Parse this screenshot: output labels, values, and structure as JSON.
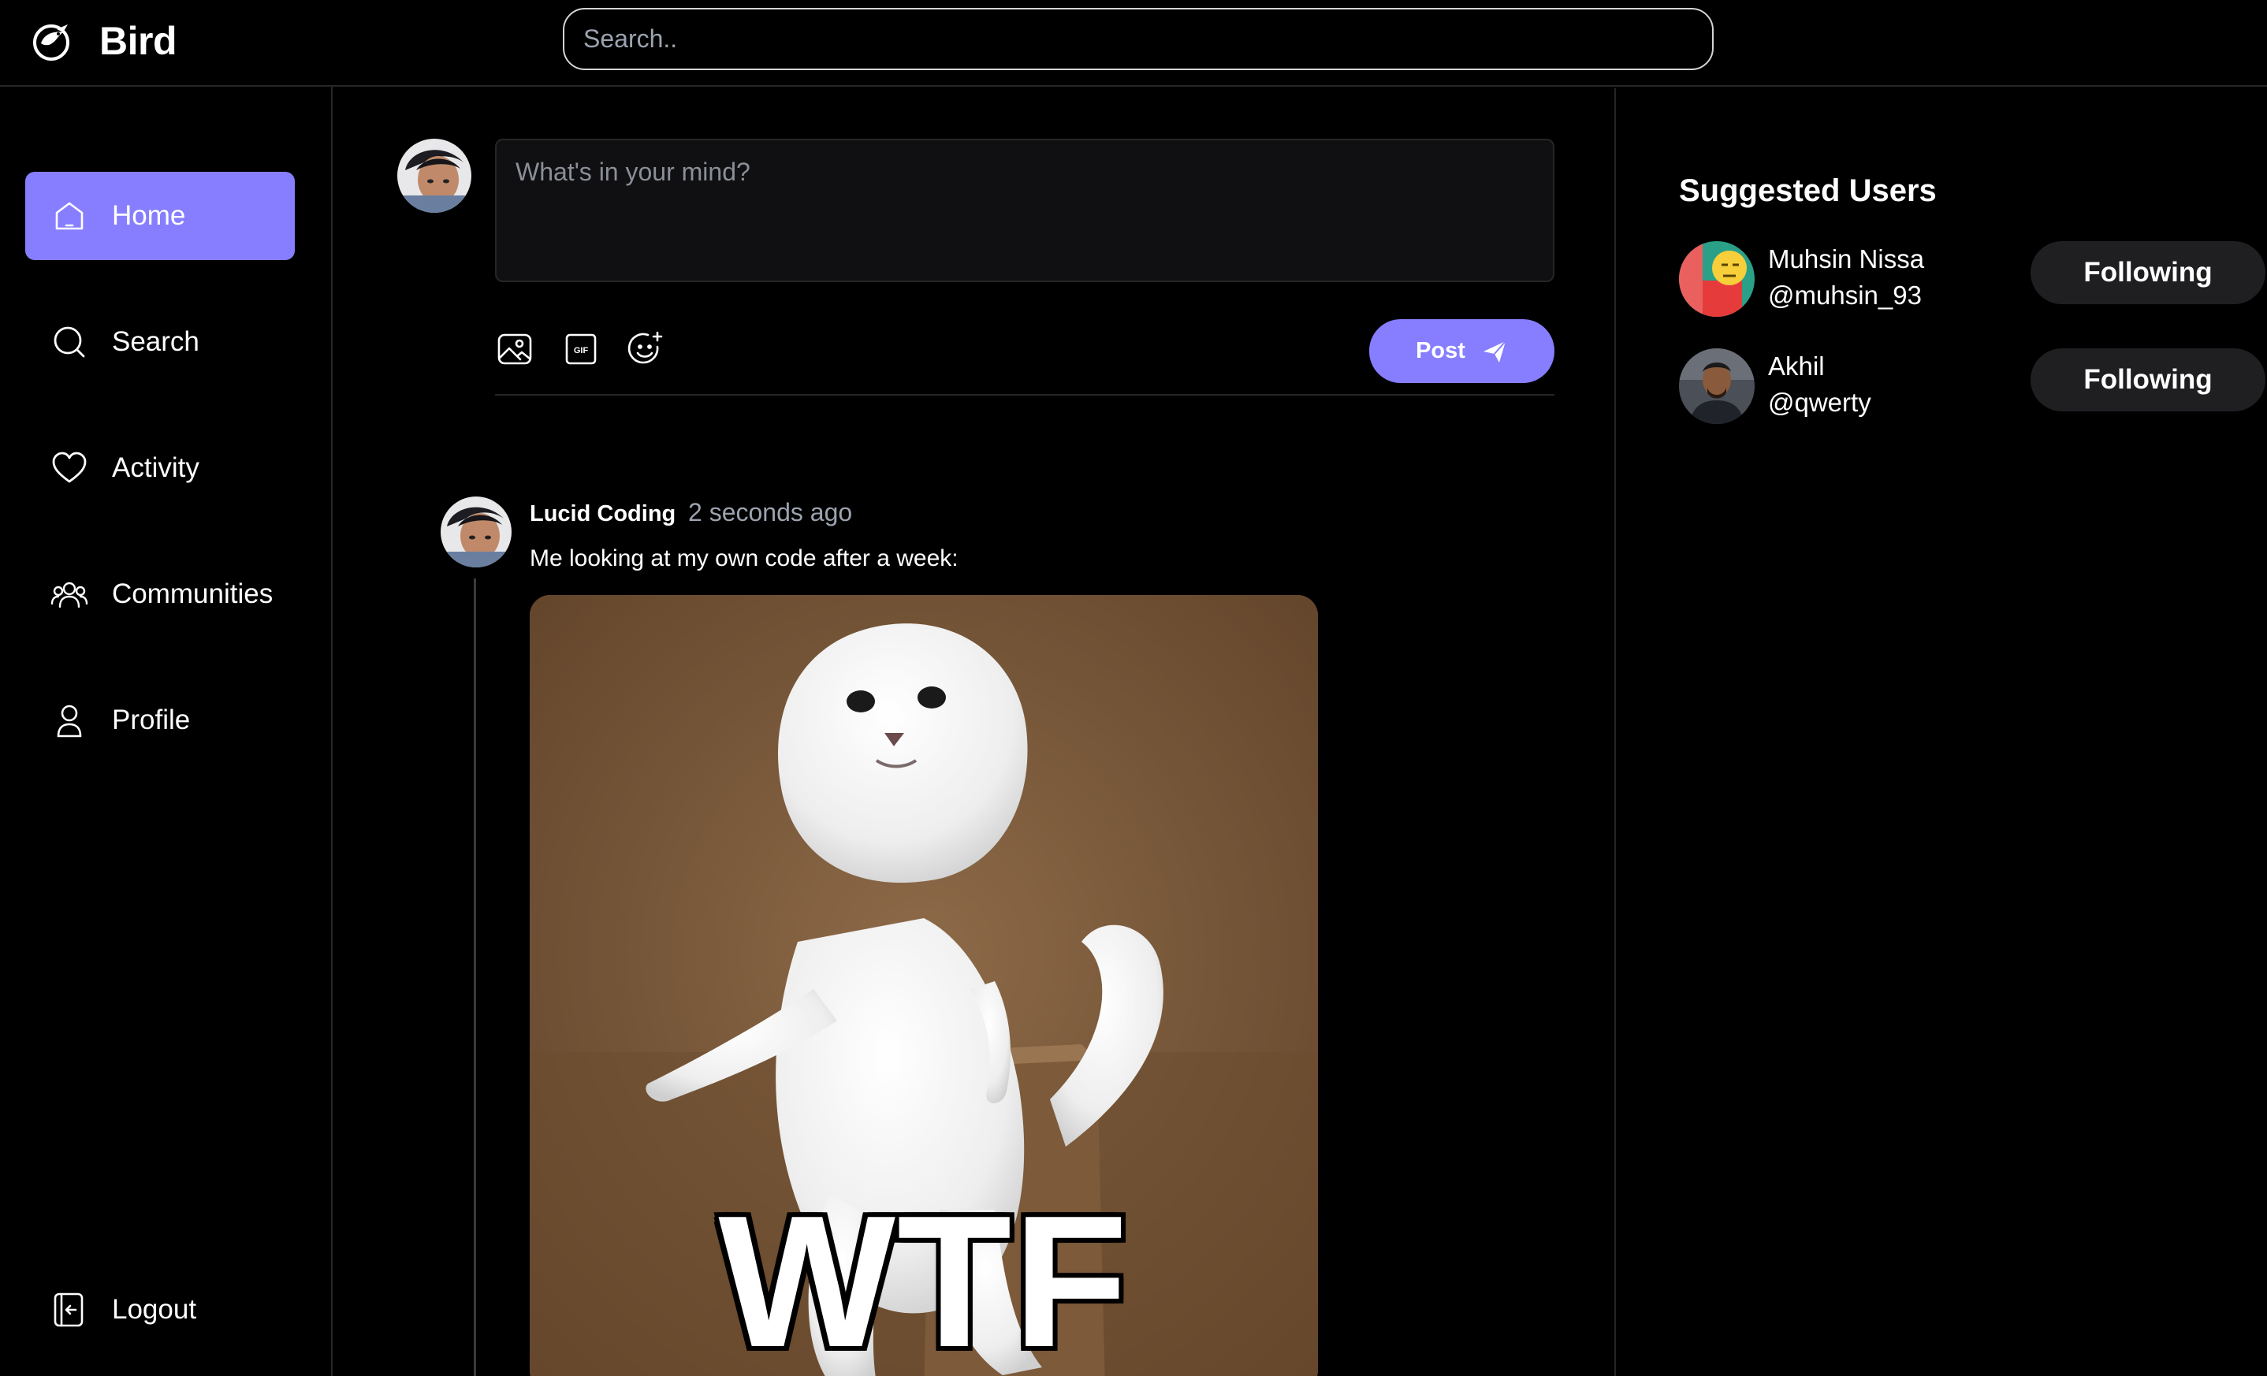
{
  "app": {
    "name": "Bird",
    "accent": "#877eff"
  },
  "header": {
    "search_placeholder": "Search.."
  },
  "sidebar": {
    "items": [
      {
        "label": "Home",
        "icon": "home-icon",
        "active": true
      },
      {
        "label": "Search",
        "icon": "search-icon",
        "active": false
      },
      {
        "label": "Activity",
        "icon": "heart-icon",
        "active": false
      },
      {
        "label": "Communities",
        "icon": "people-icon",
        "active": false
      },
      {
        "label": "Profile",
        "icon": "user-icon",
        "active": false
      }
    ],
    "logout_label": "Logout"
  },
  "composer": {
    "placeholder": "What's in your mind?",
    "tools": [
      "image-icon",
      "gif-icon",
      "emoji-icon"
    ],
    "post_label": "Post"
  },
  "feed": {
    "posts": [
      {
        "author": "Lucid Coding",
        "time": "2 seconds ago",
        "text": "Me looking at my own code after a week:",
        "media_caption": "WTF"
      }
    ]
  },
  "suggested": {
    "title": "Suggested Users",
    "users": [
      {
        "name": "Muhsin Nissa",
        "handle": "@muhsin_93",
        "button": "Following"
      },
      {
        "name": "Akhil",
        "handle": "@qwerty",
        "button": "Following"
      }
    ]
  }
}
